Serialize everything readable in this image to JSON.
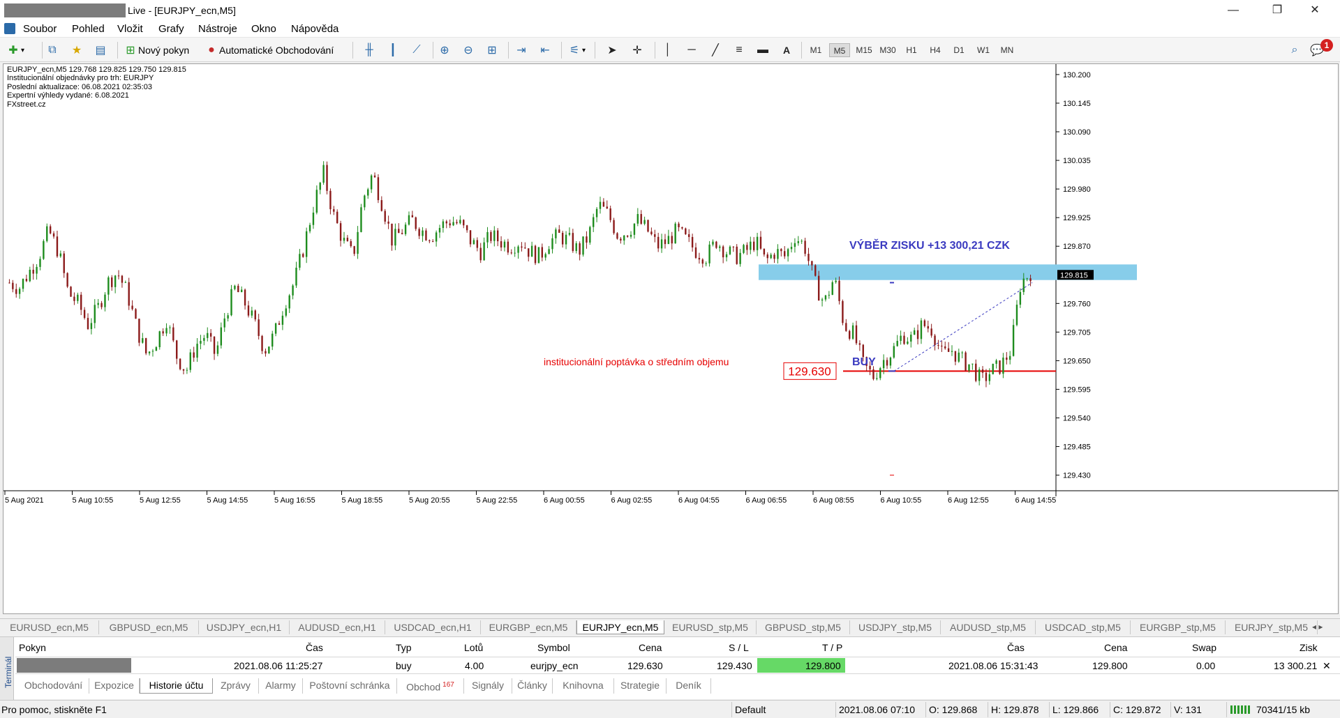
{
  "window": {
    "title": "Live - [EURJPY_ecn,M5]",
    "minimize": "—",
    "restore": "❐",
    "close": "✕"
  },
  "menu": [
    "Soubor",
    "Pohled",
    "Vložit",
    "Grafy",
    "Nástroje",
    "Okno",
    "Nápověda"
  ],
  "toolbar": {
    "new_order": "Nový pokyn",
    "algo": "Automatické Obchodování",
    "timeframes": [
      "M1",
      "M5",
      "M15",
      "M30",
      "H1",
      "H4",
      "D1",
      "W1",
      "MN"
    ],
    "active_tf": "M5",
    "text_tool": "A",
    "notif_count": "1"
  },
  "chart_info": {
    "line1": "EURJPY_ecn,M5  129.768 129.825 129.750 129.815",
    "line2": "Institucionální objednávky pro trh: EURJPY",
    "line3": "Poslední aktualizace: 06.08.2021 02:35:03",
    "line4": "Expertní výhledy vydané: 6.08.2021",
    "line5": "FXstreet.cz"
  },
  "annotations": {
    "profit": "VÝBĚR ZISKU +13 300,21 CZK",
    "buy": "BUY",
    "demand": "institucionální poptávka o středním objemu",
    "level": "129.630",
    "current_price": "129.815"
  },
  "colors": {
    "zone": "#87cdea",
    "demand_line": "#e60000",
    "annotation_blue": "#3a3ac0",
    "up": "#1e8c1e",
    "down": "#8b1a1a",
    "tp_fill": "#66d966"
  },
  "chart_data": {
    "type": "candlestick",
    "symbol": "EURJPY_ecn",
    "timeframe": "M5",
    "ylim": [
      129.4,
      130.22
    ],
    "y_ticks": [
      130.2,
      130.145,
      130.09,
      130.035,
      129.98,
      129.925,
      129.87,
      129.815,
      129.76,
      129.705,
      129.65,
      129.595,
      129.54,
      129.485,
      129.43
    ],
    "x_ticks": [
      "5 Aug 2021",
      "5 Aug 10:55",
      "5 Aug 12:55",
      "5 Aug 14:55",
      "5 Aug 16:55",
      "5 Aug 18:55",
      "5 Aug 20:55",
      "5 Aug 22:55",
      "6 Aug 00:55",
      "6 Aug 02:55",
      "6 Aug 04:55",
      "6 Aug 06:55",
      "6 Aug 08:55",
      "6 Aug 10:55",
      "6 Aug 12:55",
      "6 Aug 14:55"
    ],
    "zone": [
      129.805,
      129.835
    ],
    "demand_level": 129.63,
    "close_path": [
      129.8,
      129.79,
      129.82,
      129.85,
      129.9,
      129.86,
      129.78,
      129.76,
      129.72,
      129.75,
      129.8,
      129.82,
      129.78,
      129.71,
      129.66,
      129.69,
      129.73,
      129.66,
      129.63,
      129.68,
      129.7,
      129.66,
      129.74,
      129.79,
      129.76,
      129.72,
      129.67,
      129.7,
      129.76,
      129.8,
      129.87,
      129.95,
      130.01,
      129.93,
      129.88,
      129.85,
      129.96,
      130.01,
      129.95,
      129.88,
      129.9,
      129.92,
      129.9,
      129.89,
      129.91,
      129.92,
      129.91,
      129.88,
      129.86,
      129.89,
      129.88,
      129.87,
      129.88,
      129.86,
      129.85,
      129.88,
      129.89,
      129.88,
      129.86,
      129.89,
      129.95,
      129.93,
      129.89,
      129.9,
      129.92,
      129.9,
      129.87,
      129.88,
      129.9,
      129.88,
      129.86,
      129.85,
      129.88,
      129.86,
      129.85,
      129.86,
      129.88,
      129.84,
      129.86,
      129.85,
      129.89,
      129.87,
      129.8,
      129.76,
      129.81,
      129.72,
      129.7,
      129.64,
      129.62,
      129.65,
      129.67,
      129.7,
      129.69,
      129.72,
      129.71,
      129.66,
      129.67,
      129.65,
      129.64,
      129.61,
      129.63,
      129.64,
      129.67,
      129.8,
      129.82
    ],
    "trade": {
      "open_price": 129.63,
      "tp_price": 129.8
    }
  },
  "symbol_tabs": [
    "EURUSD_ecn,M5",
    "GBPUSD_ecn,M5",
    "USDJPY_ecn,H1",
    "AUDUSD_ecn,H1",
    "USDCAD_ecn,H1",
    "EURGBP_ecn,M5",
    "EURJPY_ecn,M5",
    "EURUSD_stp,M5",
    "GBPUSD_stp,M5",
    "USDJPY_stp,M5",
    "AUDUSD_stp,M5",
    "USDCAD_stp,M5",
    "EURGBP_stp,M5",
    "EURJPY_stp,M5"
  ],
  "active_symbol_tab": "EURJPY_ecn,M5",
  "terminal": {
    "side_label": "Terminál",
    "headers": {
      "order": "Pokyn",
      "time": "Čas",
      "type": "Typ",
      "lots": "Lotů",
      "symbol": "Symbol",
      "price": "Cena",
      "sl": "S / L",
      "tp": "T / P",
      "close_time": "Čas",
      "close_price": "Cena",
      "swap": "Swap",
      "profit": "Zisk"
    },
    "row": {
      "time": "2021.08.06 11:25:27",
      "type": "buy",
      "lots": "4.00",
      "symbol": "eurjpy_ecn",
      "price": "129.630",
      "sl": "129.430",
      "tp": "129.800",
      "close_time": "2021.08.06 15:31:43",
      "close_price": "129.800",
      "swap": "0.00",
      "profit": "13 300.21"
    },
    "tabs": [
      "Obchodování",
      "Expozice",
      "Historie účtu",
      "Zprávy",
      "Alarmy",
      "Poštovní schránka",
      "Obchod",
      "Signály",
      "Články",
      "Knihovna",
      "Strategie",
      "Deník"
    ],
    "active_tab": "Historie účtu",
    "trade_badge": "167"
  },
  "status": {
    "help": "Pro pomoc, stiskněte F1",
    "profile": "Default",
    "datetime": "2021.08.06 07:10",
    "open": "O: 129.868",
    "high": "H: 129.878",
    "low": "L: 129.866",
    "close": "C: 129.872",
    "volume": "V: 131",
    "traffic": "70341/15 kb"
  }
}
